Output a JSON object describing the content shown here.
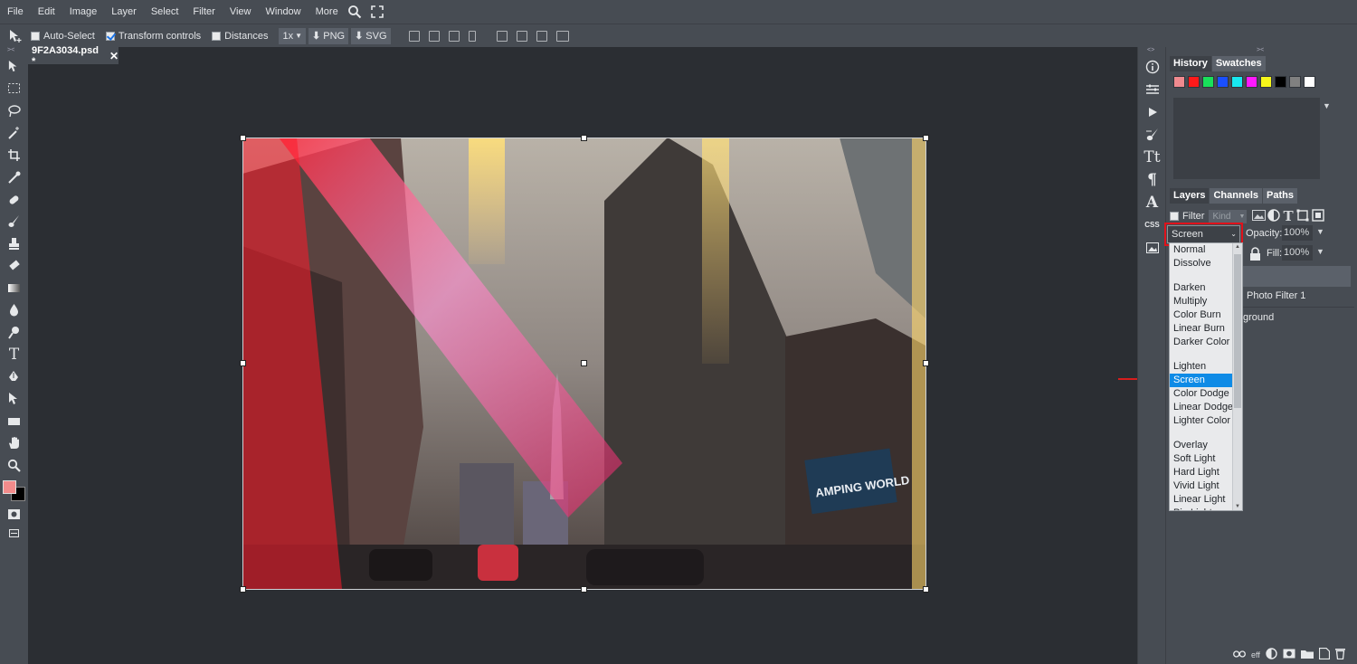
{
  "menu": [
    "File",
    "Edit",
    "Image",
    "Layer",
    "Select",
    "Filter",
    "View",
    "Window",
    "More"
  ],
  "options_bar": {
    "auto_select": {
      "label": "Auto-Select",
      "checked": false
    },
    "transform_controls": {
      "label": "Transform controls",
      "checked": true
    },
    "distances": {
      "label": "Distances",
      "checked": false
    },
    "zoom": "1x",
    "png_label": "PNG",
    "svg_label": "SVG"
  },
  "document": {
    "tab_title": "9F2A3034.psd *",
    "photo_text": "AMPING WORLD"
  },
  "history_panel": {
    "tabs": [
      "History",
      "Swatches"
    ]
  },
  "swatches": [
    "#f08a8f",
    "#ff1a1a",
    "#19e05a",
    "#1a4fff",
    "#18e8f0",
    "#ff18ff",
    "#f7f71a",
    "#000000",
    "#808080",
    "#ffffff"
  ],
  "layers_panel": {
    "tabs": [
      "Layers",
      "Channels",
      "Paths"
    ],
    "filter_label": "Filter",
    "kind_placeholder": "Kind",
    "blend_mode": "Screen",
    "opacity_label": "Opacity:",
    "opacity_value": "100%",
    "fill_label": "Fill:",
    "fill_value": "100%",
    "layers": [
      "Photo Filter 1",
      "ground"
    ]
  },
  "blend_options": [
    {
      "label": "Normal",
      "gap_before": false
    },
    {
      "label": "Dissolve",
      "gap_before": false
    },
    {
      "label": "Darken",
      "gap_before": true
    },
    {
      "label": "Multiply",
      "gap_before": false
    },
    {
      "label": "Color Burn",
      "gap_before": false
    },
    {
      "label": "Linear Burn",
      "gap_before": false
    },
    {
      "label": "Darker Color",
      "gap_before": false
    },
    {
      "label": "Lighten",
      "gap_before": true
    },
    {
      "label": "Screen",
      "gap_before": false,
      "selected": true
    },
    {
      "label": "Color Dodge",
      "gap_before": false
    },
    {
      "label": "Linear Dodge",
      "gap_before": false
    },
    {
      "label": "Lighter Color",
      "gap_before": false
    },
    {
      "label": "Overlay",
      "gap_before": true
    },
    {
      "label": "Soft Light",
      "gap_before": false
    },
    {
      "label": "Hard Light",
      "gap_before": false
    },
    {
      "label": "Vivid Light",
      "gap_before": false
    },
    {
      "label": "Linear Light",
      "gap_before": false
    },
    {
      "label": "Pin Light",
      "gap_before": false
    }
  ],
  "right_strip_label": "CSS",
  "bottom_icons_label": "eff",
  "colors": {
    "foreground": "#f28b8b",
    "background": "#000000",
    "accent": "#0f8be6",
    "highlight": "#e0121b"
  }
}
